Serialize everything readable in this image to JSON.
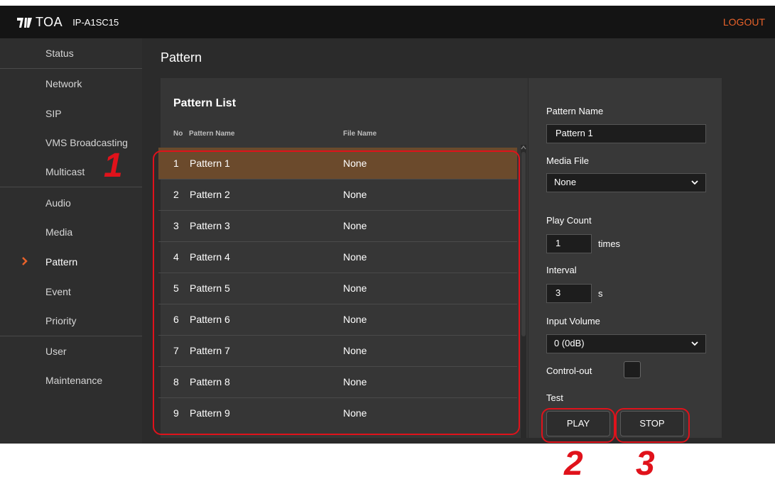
{
  "header": {
    "logo_text": "TOA",
    "model": "IP-A1SC15",
    "logout_label": "LOGOUT"
  },
  "sidebar": {
    "items": [
      {
        "label": "Status"
      },
      {
        "label": "Network"
      },
      {
        "label": "SIP"
      },
      {
        "label": "VMS Broadcasting"
      },
      {
        "label": "Multicast"
      },
      {
        "label": "Audio"
      },
      {
        "label": "Media"
      },
      {
        "label": "Pattern",
        "active": true
      },
      {
        "label": "Event"
      },
      {
        "label": "Priority"
      },
      {
        "label": "User"
      },
      {
        "label": "Maintenance"
      }
    ]
  },
  "main": {
    "title": "Pattern",
    "list": {
      "title": "Pattern List",
      "col_no": "No",
      "col_name": "Pattern Name",
      "col_file": "File Name",
      "rows": [
        {
          "no": "1",
          "name": "Pattern 1",
          "file": "None",
          "selected": true
        },
        {
          "no": "2",
          "name": "Pattern 2",
          "file": "None"
        },
        {
          "no": "3",
          "name": "Pattern 3",
          "file": "None"
        },
        {
          "no": "4",
          "name": "Pattern 4",
          "file": "None"
        },
        {
          "no": "5",
          "name": "Pattern 5",
          "file": "None"
        },
        {
          "no": "6",
          "name": "Pattern 6",
          "file": "None"
        },
        {
          "no": "7",
          "name": "Pattern 7",
          "file": "None"
        },
        {
          "no": "8",
          "name": "Pattern 8",
          "file": "None"
        },
        {
          "no": "9",
          "name": "Pattern 9",
          "file": "None"
        }
      ]
    },
    "detail": {
      "pattern_name_label": "Pattern Name",
      "pattern_name_value": "Pattern 1",
      "media_file_label": "Media File",
      "media_file_value": "None",
      "play_count_label": "Play Count",
      "play_count_value": "1",
      "play_count_unit": "times",
      "interval_label": "Interval",
      "interval_value": "3",
      "interval_unit": "s",
      "input_volume_label": "Input Volume",
      "input_volume_value": "0 (0dB)",
      "control_out_label": "Control-out",
      "test_label": "Test",
      "play_label": "PLAY",
      "stop_label": "STOP"
    }
  },
  "callouts": {
    "marker_1": "1",
    "marker_2": "2",
    "marker_3": "3"
  },
  "colors": {
    "accent_logout": "#e8622a",
    "selected_row": "#6b4a2c",
    "callout_red": "#e0121b"
  }
}
